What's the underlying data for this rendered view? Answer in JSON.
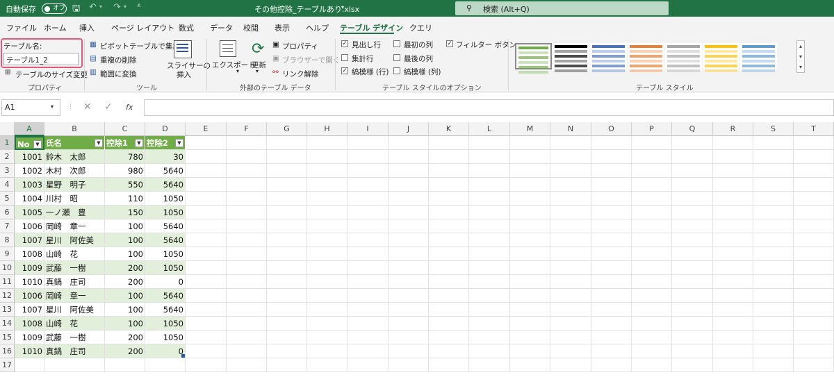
{
  "titlebar": {
    "autosave_label": "自動保存",
    "autosave_state": "オフ",
    "filename": "その他控除_テーブルあり.xlsx",
    "filename_caret": "▾",
    "search_placeholder": "検索 (Alt+Q)"
  },
  "tabs": [
    {
      "label": "ファイル"
    },
    {
      "label": "ホーム"
    },
    {
      "label": "挿入"
    },
    {
      "label": "ページ レイアウト"
    },
    {
      "label": "数式"
    },
    {
      "label": "データ"
    },
    {
      "label": "校閲"
    },
    {
      "label": "表示"
    },
    {
      "label": "ヘルプ"
    },
    {
      "label": "テーブル デザイン"
    },
    {
      "label": "クエリ"
    }
  ],
  "ribbon": {
    "properties": {
      "table_name_label": "テーブル名:",
      "table_name_value": "テーブル1_2",
      "resize_label": "テーブルのサイズ変更",
      "group_label": "プロパティ"
    },
    "tools": {
      "pivot_label": "ピボットテーブルで集計",
      "remove_dup_label": "重複の削除",
      "convert_label": "範囲に変換",
      "slicer_line1": "スライサーの",
      "slicer_line2": "挿入",
      "group_label": "ツール"
    },
    "external": {
      "export_label": "エクスポート",
      "refresh_label": "更新",
      "properties_label": "プロパティ",
      "browser_label": "ブラウザーで開く",
      "unlink_label": "リンク解除",
      "group_label": "外部のテーブル データ"
    },
    "style_options": {
      "header_row": "見出し行",
      "total_row": "集計行",
      "banded_rows": "縞模様 (行)",
      "first_column": "最初の列",
      "last_column": "最後の列",
      "banded_columns": "縞模様 (列)",
      "filter_button": "フィルター ボタン",
      "group_label": "テーブル スタイルのオプション"
    },
    "table_styles": {
      "group_label": "テーブル スタイル",
      "swatches": [
        "#70ad47",
        "#000000",
        "#4472c4",
        "#ed7d31",
        "#a5a5a5",
        "#ffc000",
        "#5b9bd5"
      ]
    }
  },
  "formula_bar": {
    "name_box": "A1",
    "fx": "fx",
    "content": ""
  },
  "columns": [
    "A",
    "B",
    "C",
    "D",
    "E",
    "F",
    "G",
    "H",
    "I",
    "J",
    "K",
    "L",
    "M",
    "N",
    "O",
    "P",
    "Q",
    "R",
    "S",
    "T"
  ],
  "row_numbers": [
    "1",
    "2",
    "3",
    "4",
    "5",
    "6",
    "7",
    "8",
    "9",
    "10",
    "11",
    "12",
    "13",
    "14",
    "15",
    "16",
    "17"
  ],
  "table": {
    "headers": [
      "No",
      "氏名",
      "控除1",
      "控除2"
    ],
    "rows": [
      [
        "1001",
        "鈴木　太郎",
        "780",
        "30"
      ],
      [
        "1002",
        "木村　次郎",
        "980",
        "5640"
      ],
      [
        "1003",
        "星野　明子",
        "550",
        "5640"
      ],
      [
        "1004",
        "川村　昭",
        "110",
        "1050"
      ],
      [
        "1005",
        "一ノ瀬　豊",
        "150",
        "1050"
      ],
      [
        "1006",
        "岡崎　章一",
        "100",
        "5640"
      ],
      [
        "1007",
        "星川　阿佐美",
        "100",
        "5640"
      ],
      [
        "1008",
        "山崎　花",
        "100",
        "1050"
      ],
      [
        "1009",
        "武藤　一樹",
        "200",
        "1050"
      ],
      [
        "1010",
        "真鍋　庄司",
        "200",
        "0"
      ],
      [
        "1006",
        "岡崎　章一",
        "100",
        "5640"
      ],
      [
        "1007",
        "星川　阿佐美",
        "100",
        "5640"
      ],
      [
        "1008",
        "山崎　花",
        "100",
        "1050"
      ],
      [
        "1009",
        "武藤　一樹",
        "200",
        "1050"
      ],
      [
        "1010",
        "真鍋　庄司",
        "200",
        "0"
      ]
    ]
  },
  "colors": {
    "brand": "#217346",
    "table_header": "#70ad47",
    "table_band": "#e2efda",
    "highlight": "#e8577a"
  }
}
